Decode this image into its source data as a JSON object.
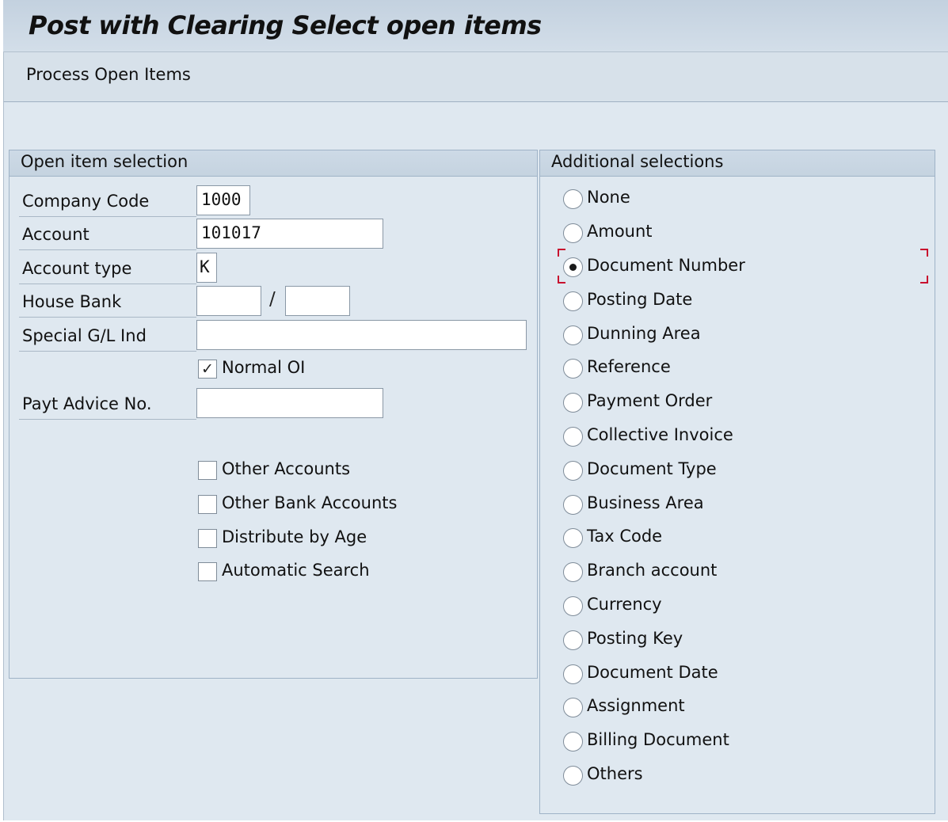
{
  "window": {
    "title": "Post with Clearing Select open items"
  },
  "toolbar": {
    "process_open_items": "Process Open Items"
  },
  "open_item_selection": {
    "title": "Open item selection",
    "company_code": {
      "label": "Company Code",
      "value": "1000"
    },
    "account": {
      "label": "Account",
      "value": "101017"
    },
    "account_type": {
      "label": "Account type",
      "value": "K"
    },
    "house_bank": {
      "label": "House Bank",
      "value1": "",
      "value2": "",
      "separator": "/"
    },
    "special_gl_ind": {
      "label": "Special G/L Ind",
      "value": ""
    },
    "normal_oi": {
      "label": "Normal OI",
      "checked": true,
      "mark": "✓"
    },
    "payt_advice_no": {
      "label": "Payt Advice No.",
      "value": ""
    },
    "options": [
      {
        "label": "Other Accounts",
        "checked": false
      },
      {
        "label": "Other Bank Accounts",
        "checked": false
      },
      {
        "label": "Distribute by Age",
        "checked": false
      },
      {
        "label": "Automatic Search",
        "checked": false
      }
    ]
  },
  "additional_selections": {
    "title": "Additional selections",
    "selected": "Document Number",
    "options": [
      "None",
      "Amount",
      "Document Number",
      "Posting Date",
      "Dunning Area",
      "Reference",
      "Payment Order",
      "Collective Invoice",
      "Document Type",
      "Business Area",
      "Tax Code",
      "Branch account",
      "Currency",
      "Posting Key",
      "Document Date",
      "Assignment",
      "Billing Document",
      "Others"
    ]
  },
  "colors": {
    "focus": "#c8102e",
    "header_bg": "#c3d1df",
    "canvas_bg": "#dfe8f0"
  }
}
